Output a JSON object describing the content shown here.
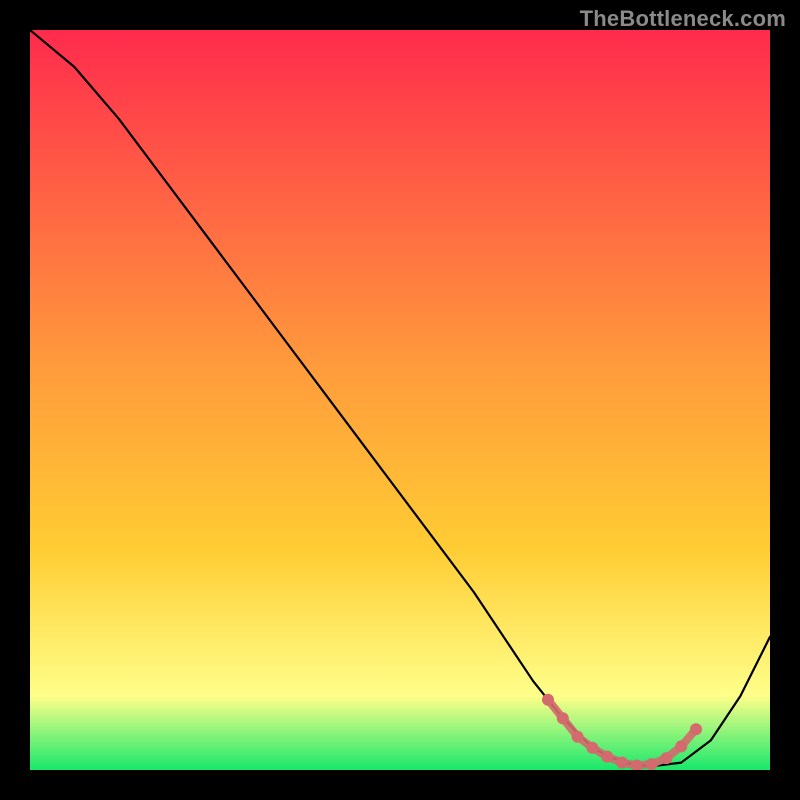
{
  "watermark": "TheBottleneck.com",
  "colors": {
    "gradient_top": "#ff2b4d",
    "gradient_mid": "#ffcc33",
    "gradient_low": "#ffff8a",
    "gradient_bottom": "#17e86b",
    "curve": "#000000",
    "marker": "#d36a6d",
    "background": "#000000"
  },
  "chart_data": {
    "type": "line",
    "title": "",
    "xlabel": "",
    "ylabel": "",
    "xlim": [
      0,
      100
    ],
    "ylim": [
      0,
      100
    ],
    "series": [
      {
        "name": "bottleneck_curve",
        "x": [
          0,
          6,
          12,
          18,
          24,
          30,
          36,
          42,
          48,
          54,
          60,
          64,
          68,
          72,
          76,
          80,
          84,
          88,
          92,
          96,
          100
        ],
        "values": [
          100,
          95,
          88,
          80,
          72,
          64,
          56,
          48,
          40,
          32,
          24,
          18,
          12,
          7,
          3,
          1,
          0.5,
          1,
          4,
          10,
          18
        ]
      }
    ],
    "optimal_band": {
      "name": "optimal_range_markers",
      "x": [
        70,
        72,
        74,
        76,
        78,
        80,
        82,
        84,
        86,
        88,
        90
      ],
      "values": [
        9.5,
        7.0,
        4.5,
        3.0,
        1.8,
        1.0,
        0.6,
        0.8,
        1.6,
        3.2,
        5.5
      ]
    }
  }
}
